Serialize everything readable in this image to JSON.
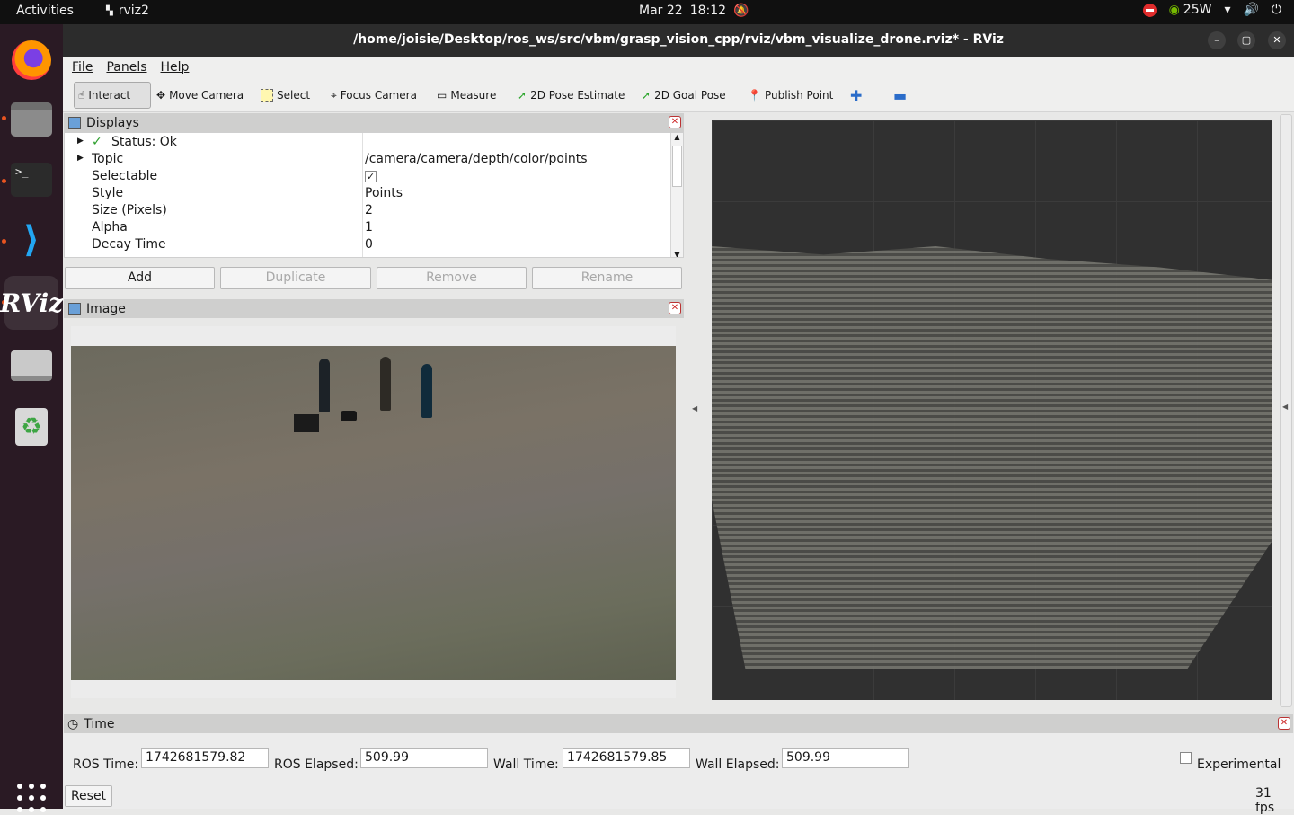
{
  "topbar": {
    "activities": "Activities",
    "app_name": "rviz2",
    "date": "Mar 22",
    "time": "18:12",
    "power_label": "25W"
  },
  "window": {
    "title": "/home/joisie/Desktop/ros_ws/src/vbm/grasp_vision_cpp/rviz/vbm_visualize_drone.rviz* - RViz"
  },
  "menu": [
    "File",
    "Panels",
    "Help"
  ],
  "toolbar": {
    "tools": [
      "Interact",
      "Move Camera",
      "Select",
      "Focus Camera",
      "Measure",
      "2D Pose Estimate",
      "2D Goal Pose",
      "Publish Point"
    ],
    "active_tool": "Interact"
  },
  "displays": {
    "title": "Displays",
    "rows": [
      {
        "key": "Status: Ok",
        "value": ""
      },
      {
        "key": "Topic",
        "value": "/camera/camera/depth/color/points"
      },
      {
        "key": "Selectable",
        "value": ""
      },
      {
        "key": "Style",
        "value": "Points"
      },
      {
        "key": "Size (Pixels)",
        "value": "2"
      },
      {
        "key": "Alpha",
        "value": "1"
      },
      {
        "key": "Decay Time",
        "value": "0"
      }
    ],
    "selectable_checked": true,
    "buttons": [
      "Add",
      "Duplicate",
      "Remove",
      "Rename"
    ]
  },
  "image_panel": {
    "title": "Image"
  },
  "time_panel": {
    "title": "Time",
    "ros_time_label": "ROS Time:",
    "ros_time": "1742681579.82",
    "ros_elapsed_label": "ROS Elapsed:",
    "ros_elapsed": "509.99",
    "wall_time_label": "Wall Time:",
    "wall_time": "1742681579.85",
    "wall_elapsed_label": "Wall Elapsed:",
    "wall_elapsed": "509.99",
    "experimental_label": "Experimental",
    "experimental_checked": false,
    "reset_label": "Reset",
    "fps": "31 fps"
  },
  "colors": {
    "accent": "#e95420",
    "status_ok": "#2a9d2a",
    "close_red": "#cc2222"
  }
}
